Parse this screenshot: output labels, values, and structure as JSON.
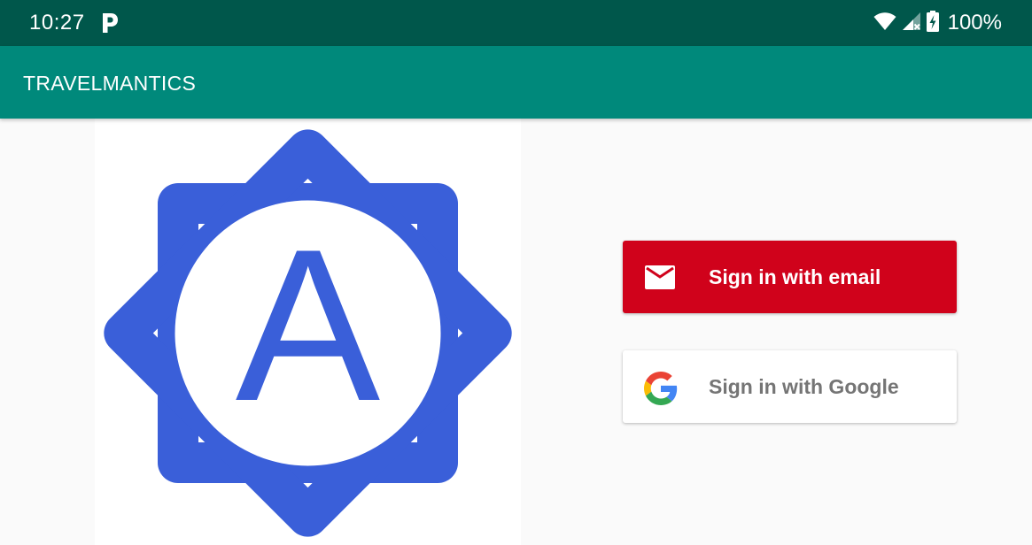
{
  "status_bar": {
    "time": "10:27",
    "app_icon": "parking-p-icon",
    "icons": [
      "wifi-icon",
      "cell-signal-no-data-icon",
      "battery-charging-icon"
    ],
    "battery": "100%"
  },
  "app_bar": {
    "title": "TRAVELMANTICS"
  },
  "logo": {
    "letter": "A",
    "icon": "star-badge-logo",
    "color": "#3a5fd9"
  },
  "buttons": {
    "email": {
      "label": "Sign in with email",
      "icon": "mail-icon",
      "color": "#d0021b"
    },
    "google": {
      "label": "Sign in with Google",
      "icon": "google-g-icon",
      "color": "#ffffff"
    }
  },
  "colors": {
    "status_bar": "#00574b",
    "app_bar": "#00897b",
    "background": "#fafafa"
  }
}
